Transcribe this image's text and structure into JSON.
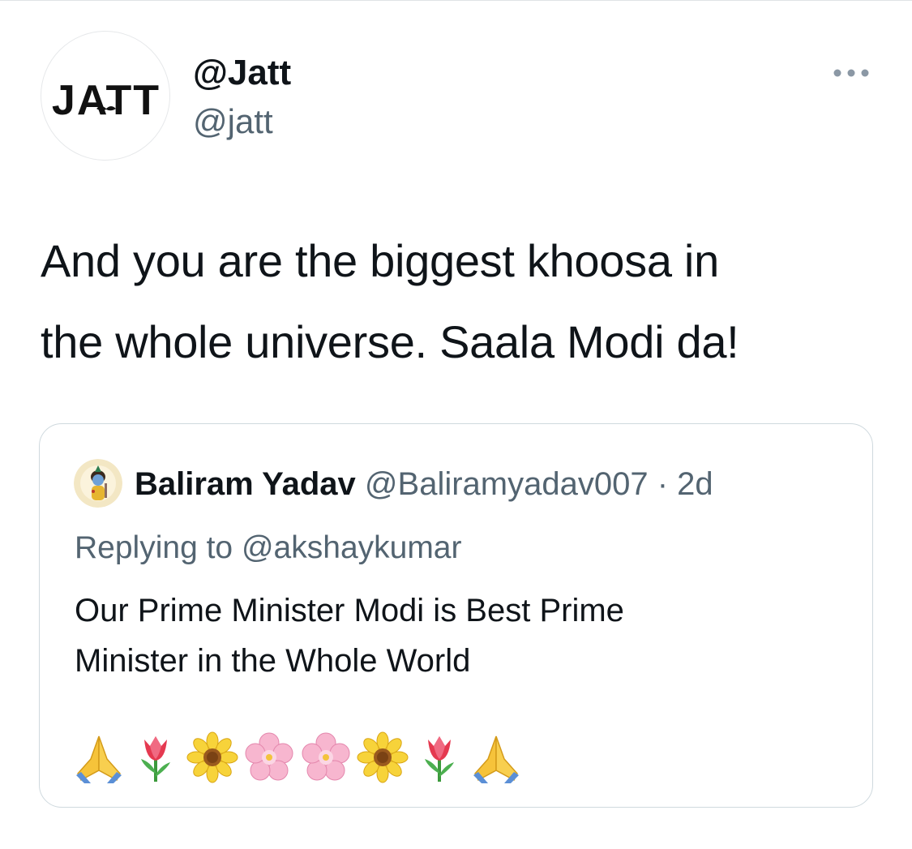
{
  "tweet": {
    "author": {
      "name": "@Jatt",
      "handle": "@jatt",
      "logo_text": "JATT"
    },
    "text_line1": "And you are the biggest khoosa in",
    "text_line2": "the whole universe. Saala Modi da!",
    "more_icon": "more-horizontal-icon"
  },
  "quoted": {
    "name": "Baliram Yadav",
    "handle": "@Baliramyadav007",
    "separator": "·",
    "time": "2d",
    "reply_prefix": "Replying to",
    "reply_mention": "@akshaykumar",
    "text_line1": "Our Prime Minister Modi is Best Prime",
    "text_line2": "Minister in the Whole World",
    "emojis": [
      "folded-hands",
      "tulip",
      "sunflower",
      "cherry-blossom",
      "cherry-blossom",
      "sunflower",
      "tulip",
      "folded-hands"
    ]
  },
  "colors": {
    "text_primary": "#0f1419",
    "text_secondary": "#536471",
    "border": "#cfd9de"
  }
}
